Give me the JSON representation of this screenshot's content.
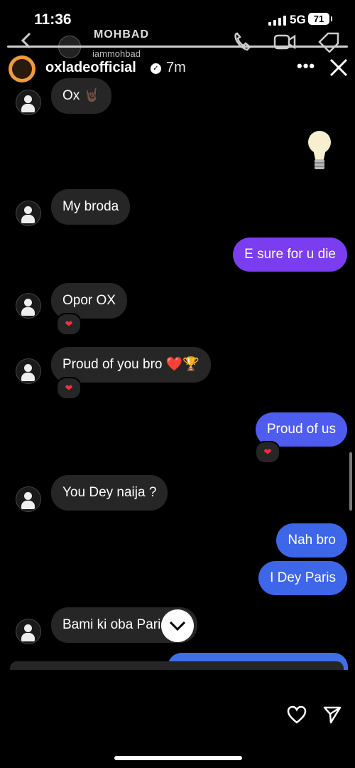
{
  "status_bar": {
    "time": "11:36",
    "network": "5G",
    "battery": "71"
  },
  "background_chat": {
    "name": "MOHBAD",
    "handle": "iammohbad"
  },
  "story": {
    "username": "oxladeofficial",
    "time": "7m",
    "more": "•••"
  },
  "messages": [
    {
      "side": "in",
      "text": "Ox 🤘🏿",
      "reaction": ""
    },
    {
      "side": "in",
      "text": "My broda",
      "reaction": ""
    },
    {
      "side": "out",
      "text": "E sure for u die",
      "reaction": ""
    },
    {
      "side": "in",
      "text": "Opor OX",
      "reaction": "❤"
    },
    {
      "side": "in",
      "text": "Proud of you bro ❤️🏆",
      "reaction": "❤"
    },
    {
      "side": "out",
      "text": "Proud of us",
      "reaction": "❤"
    },
    {
      "side": "in",
      "text": "You Dey naija ?",
      "reaction": ""
    },
    {
      "side": "out",
      "text": "Nah bro",
      "reaction": ""
    },
    {
      "side": "out",
      "text": "I Dey Paris",
      "reaction": ""
    },
    {
      "side": "in",
      "text": "Bami ki oba Paris oo",
      "reaction": ""
    }
  ],
  "icons": {
    "bulb": "light-bulb-emoji",
    "scroll": "chevron-down-icon",
    "like": "heart-outline-icon",
    "share": "send-icon",
    "close": "close-icon"
  },
  "colors": {
    "outgoing_purple": "#7a3df0",
    "outgoing_blue": "#3d66e8",
    "incoming": "#262626",
    "avatar_ring": "#f29a3b"
  }
}
